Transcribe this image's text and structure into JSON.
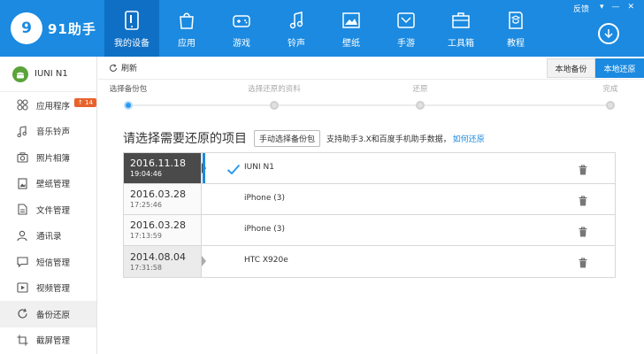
{
  "app": {
    "logo_mark": "9",
    "logo_text": "91助手"
  },
  "top_nav": [
    {
      "label": "我的设备",
      "icon": "my-device-icon",
      "active": true
    },
    {
      "label": "应用",
      "icon": "apps-icon",
      "active": false
    },
    {
      "label": "游戏",
      "icon": "gamepad-icon",
      "active": false
    },
    {
      "label": "铃声",
      "icon": "music-note-icon",
      "active": false
    },
    {
      "label": "壁纸",
      "icon": "wallpaper-icon",
      "active": false
    },
    {
      "label": "手游",
      "icon": "mobile-game-icon",
      "active": false
    },
    {
      "label": "工具箱",
      "icon": "toolbox-icon",
      "active": false
    },
    {
      "label": "教程",
      "icon": "tutorial-icon",
      "active": false
    }
  ],
  "window": {
    "feedback": "反馈"
  },
  "device": {
    "name": "IUNI N1",
    "icon": "android-icon"
  },
  "sidebar": [
    {
      "label": "应用程序",
      "icon": "apps-icon",
      "badge": "14",
      "active": false
    },
    {
      "label": "音乐铃声",
      "icon": "music-note-icon",
      "active": false
    },
    {
      "label": "照片相簿",
      "icon": "photo-icon",
      "active": false
    },
    {
      "label": "壁纸管理",
      "icon": "wallpaper-icon",
      "active": false
    },
    {
      "label": "文件管理",
      "icon": "file-icon",
      "active": false
    },
    {
      "label": "通讯录",
      "icon": "contacts-icon",
      "active": false
    },
    {
      "label": "短信管理",
      "icon": "sms-icon",
      "active": false
    },
    {
      "label": "视频管理",
      "icon": "video-icon",
      "active": false
    },
    {
      "label": "备份还原",
      "icon": "backup-icon",
      "active": true
    },
    {
      "label": "截屏管理",
      "icon": "screenshot-icon",
      "active": false
    }
  ],
  "toolbar": {
    "refresh_label": "刷新",
    "local_backup": "本地备份",
    "local_restore": "本地还原"
  },
  "steps": [
    {
      "label": "选择备份包",
      "current": true
    },
    {
      "label": "选择还原的资料",
      "current": false
    },
    {
      "label": "还原",
      "current": false
    },
    {
      "label": "完成",
      "current": false
    }
  ],
  "heading": {
    "title": "请选择需要还原的项目",
    "manual_button": "手动选择备份包",
    "support_text": "支持助手3.X和百度手机助手数据，",
    "how_link": "如何还原"
  },
  "backups": [
    {
      "date": "2016.11.18",
      "time": "19:04:46",
      "device": "IUNI N1",
      "selected": true,
      "style": "selected"
    },
    {
      "date": "2016.03.28",
      "time": "17:25:46",
      "device": "iPhone (3)",
      "selected": false,
      "style": "plain"
    },
    {
      "date": "2016.03.28",
      "time": "17:13:59",
      "device": "iPhone (3)",
      "selected": false,
      "style": "plain"
    },
    {
      "date": "2014.08.04",
      "time": "17:31:58",
      "device": "HTC X920e",
      "selected": false,
      "style": "gray"
    }
  ],
  "colors": {
    "brand_blue": "#1b8ae0",
    "nav_active": "#0f6fc4",
    "badge_orange": "#e8622c",
    "android_green": "#5aa33a"
  }
}
